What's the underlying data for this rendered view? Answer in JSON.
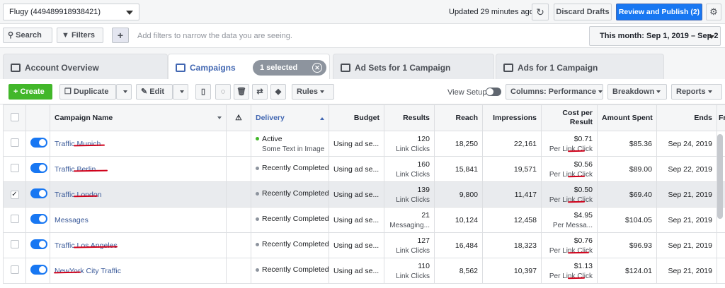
{
  "topbar": {
    "account": "Flugy (449489918938421)",
    "updated": "Updated 29 minutes ago",
    "discard": "Discard Drafts",
    "publish": "Review and Publish (2)"
  },
  "filterbar": {
    "search": "Search",
    "filters": "Filters",
    "hint": "Add filters to narrow the data you are seeing.",
    "date_range": "This month: Sep 1, 2019 – Sep 2"
  },
  "tabs": {
    "account_overview": "Account Overview",
    "campaigns": "Campaigns",
    "selected": "1 selected",
    "ad_sets": "Ad Sets for 1 Campaign",
    "ads": "Ads for 1 Campaign"
  },
  "toolbar": {
    "create": "Create",
    "duplicate": "Duplicate",
    "edit": "Edit",
    "rules": "Rules",
    "view_setup": "View Setup",
    "columns": "Columns: Performance",
    "breakdown": "Breakdown",
    "reports": "Reports"
  },
  "table": {
    "headers": {
      "name": "Campaign Name",
      "delivery": "Delivery",
      "budget": "Budget",
      "results": "Results",
      "reach": "Reach",
      "impressions": "Impressions",
      "cost_line1": "Cost per",
      "cost_line2": "Result",
      "spent": "Amount Spent",
      "ends": "Ends",
      "freq": "Fre"
    },
    "rows": [
      {
        "name": "Traffic Munich",
        "delivery": "Active",
        "delivery_sub": "Some Text in Image",
        "budget": "Using ad se...",
        "results": "120",
        "results_sub": "Link Clicks",
        "reach": "18,250",
        "impressions": "22,161",
        "cost": "$0.71",
        "cost_sub": "Per Link Click",
        "spent": "$85.36",
        "ends": "Sep 24, 2019"
      },
      {
        "name": "Traffic Berlin",
        "delivery": "Recently Completed",
        "delivery_sub": "",
        "budget": "Using ad se...",
        "results": "160",
        "results_sub": "Link Clicks",
        "reach": "15,841",
        "impressions": "19,571",
        "cost": "$0.56",
        "cost_sub": "Per Link Click",
        "spent": "$89.00",
        "ends": "Sep 22, 2019"
      },
      {
        "name": "Traffic London",
        "delivery": "Recently Completed",
        "delivery_sub": "",
        "budget": "Using ad se...",
        "results": "139",
        "results_sub": "Link Clicks",
        "reach": "9,800",
        "impressions": "11,417",
        "cost": "$0.50",
        "cost_sub": "Per Link Click",
        "spent": "$69.40",
        "ends": "Sep 21, 2019"
      },
      {
        "name": "Messages",
        "delivery": "Recently Completed",
        "delivery_sub": "",
        "budget": "Using ad se...",
        "results": "21",
        "results_sub": "Messaging...",
        "reach": "10,124",
        "impressions": "12,458",
        "cost": "$4.95",
        "cost_sub": "Per Messa...",
        "spent": "$104.05",
        "ends": "Sep 21, 2019"
      },
      {
        "name": "Traffic Los Angeles",
        "delivery": "Recently Completed",
        "delivery_sub": "",
        "budget": "Using ad se...",
        "results": "127",
        "results_sub": "Link Clicks",
        "reach": "16,484",
        "impressions": "18,323",
        "cost": "$0.76",
        "cost_sub": "Per Link Click",
        "spent": "$96.93",
        "ends": "Sep 21, 2019"
      },
      {
        "name": "NewYork City Traffic",
        "delivery": "Recently Completed",
        "delivery_sub": "",
        "budget": "Using ad se...",
        "results": "110",
        "results_sub": "Link Clicks",
        "reach": "8,562",
        "impressions": "10,397",
        "cost": "$1.13",
        "cost_sub": "Per Link Click",
        "spent": "$124.01",
        "ends": "Sep 21, 2019"
      }
    ]
  }
}
